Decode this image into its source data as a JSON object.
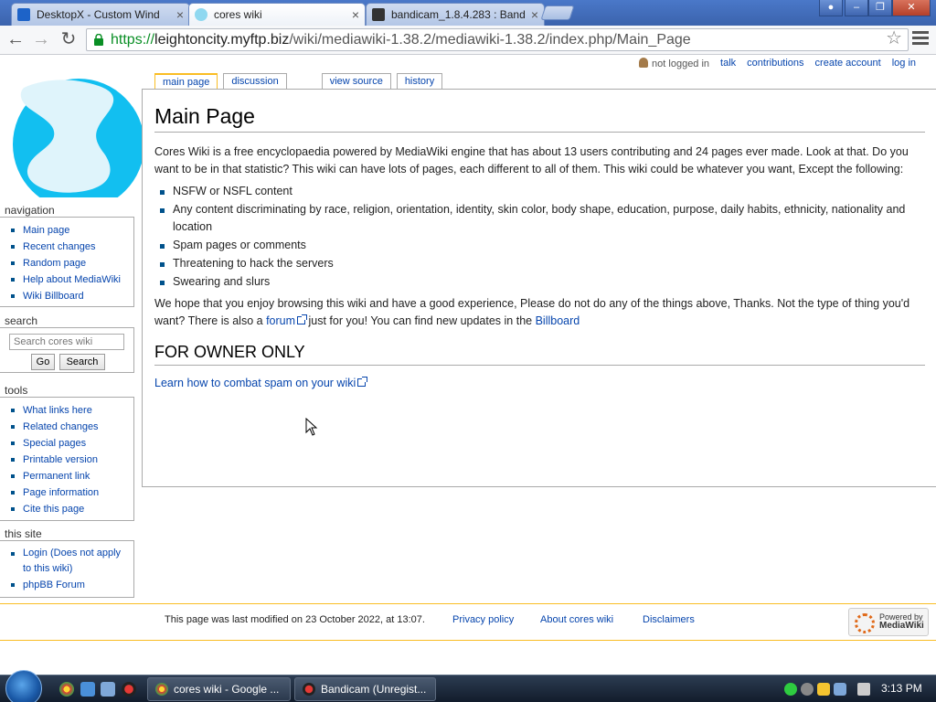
{
  "browser": {
    "tabs": [
      {
        "title": "DesktopX - Custom Wind",
        "icon": "desktopx-icon",
        "close": "×"
      },
      {
        "title": "cores wiki",
        "icon": "cores-wiki-favicon",
        "close": "×"
      },
      {
        "title": "bandicam_1.8.4.283 : Band",
        "icon": "archive-icon",
        "close": "×"
      }
    ],
    "url_scheme": "https://",
    "url_host": "leightoncity.myftp.biz",
    "url_path": "/wiki/mediawiki-1.38.2/mediawiki-1.38.2/index.php/Main_Page"
  },
  "personal": {
    "not_logged_in": "not logged in",
    "talk": "talk",
    "contributions": "contributions",
    "create_account": "create account",
    "log_in": "log in"
  },
  "content_tabs": {
    "main_page": "main page",
    "discussion": "discussion",
    "view_source": "view source",
    "history": "history"
  },
  "article": {
    "title": "Main Page",
    "intro": "Cores Wiki is a free encyclopaedia powered by MediaWiki engine that has about 13 users contributing and 24 pages ever made. Look at that. Do you want to be in that statistic? This wiki can have lots of pages, each different to all of them. This wiki could be whatever you want, Except the following:",
    "rules": [
      "NSFW or NSFL content",
      "Any content discriminating by race, religion, orientation, identity, skin color, body shape, education, purpose, daily habits, ethnicity, nationality and location",
      "Spam pages or comments",
      "Threatening to hack the servers",
      "Swearing and slurs"
    ],
    "closing_1": "We hope that you enjoy browsing this wiki and have a good experience, Please do not do any of the things above, Thanks. Not the type of thing you'd want? There is also a ",
    "forum_link": "forum",
    "closing_2": " just for you! You can find new updates in the ",
    "billboard_link": "Billboard",
    "owner_heading": "FOR OWNER ONLY",
    "spam_link": "Learn how to combat spam on your wiki"
  },
  "sidebar": {
    "navigation": {
      "heading": "navigation",
      "items": [
        "Main page",
        "Recent changes",
        "Random page",
        "Help about MediaWiki",
        "Wiki Billboard"
      ]
    },
    "search": {
      "heading": "search",
      "placeholder": "Search cores wiki",
      "go": "Go",
      "search": "Search"
    },
    "tools": {
      "heading": "tools",
      "items": [
        "What links here",
        "Related changes",
        "Special pages",
        "Printable version",
        "Permanent link",
        "Page information",
        "Cite this page"
      ]
    },
    "this_site": {
      "heading": "this site",
      "items": [
        "Login (Does not apply to this wiki)",
        "phpBB Forum"
      ]
    }
  },
  "footer": {
    "last_modified": "This page was last modified on 23 October 2022, at 13:07.",
    "privacy": "Privacy policy",
    "about": "About cores wiki",
    "disclaimers": "Disclaimers",
    "powered_1": "Powered by",
    "powered_2": "MediaWiki"
  },
  "taskbar": {
    "tasks": [
      {
        "label": "cores wiki - Google ...",
        "icon": "chrome-icon"
      },
      {
        "label": "Bandicam (Unregist...",
        "icon": "bandicam-icon"
      }
    ],
    "clock": "3:13 PM"
  },
  "colors": {
    "link": "#0645ad",
    "accent": "#fabd23",
    "logo_cyan": "#12bff0"
  }
}
